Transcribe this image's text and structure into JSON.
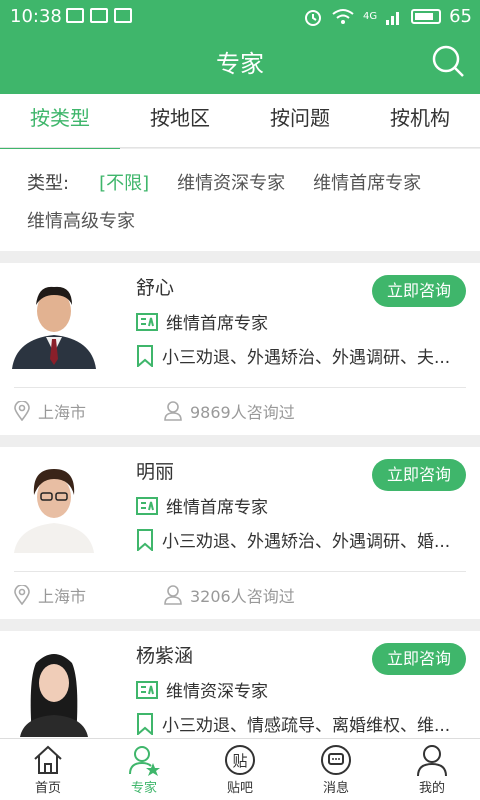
{
  "status_bar": {
    "time": "10:38",
    "battery": "65",
    "network": "4G"
  },
  "app_bar": {
    "title": "专家"
  },
  "tabs": [
    {
      "label": "按类型",
      "active": true
    },
    {
      "label": "按地区",
      "active": false
    },
    {
      "label": "按问题",
      "active": false
    },
    {
      "label": "按机构",
      "active": false
    }
  ],
  "filter": {
    "label": "类型:",
    "options": [
      "[不限]",
      "维情资深专家",
      "维情首席专家",
      "维情高级专家"
    ],
    "selected": "[不限]"
  },
  "experts": [
    {
      "name": "舒心",
      "title": "维情首席专家",
      "tags": "小三劝退、外遇矫治、外遇调研、夫...",
      "city": "上海市",
      "consult_count": "9869人咨询过",
      "button": "立即咨询"
    },
    {
      "name": "明丽",
      "title": "维情首席专家",
      "tags": "小三劝退、外遇矫治、外遇调研、婚...",
      "city": "上海市",
      "consult_count": "3206人咨询过",
      "button": "立即咨询"
    },
    {
      "name": "杨紫涵",
      "title": "维情资深专家",
      "tags": "小三劝退、情感疏导、离婚维权、维...",
      "city": "",
      "consult_count": "",
      "button": "立即咨询"
    }
  ],
  "bottom_nav": [
    {
      "label": "首页",
      "icon": "home-icon",
      "active": false
    },
    {
      "label": "专家",
      "icon": "expert-icon",
      "active": true
    },
    {
      "label": "贴吧",
      "icon": "forum-icon",
      "active": false
    },
    {
      "label": "消息",
      "icon": "message-icon",
      "active": false
    },
    {
      "label": "我的",
      "icon": "profile-icon",
      "active": false
    }
  ],
  "colors": {
    "accent": "#3fb66b"
  }
}
